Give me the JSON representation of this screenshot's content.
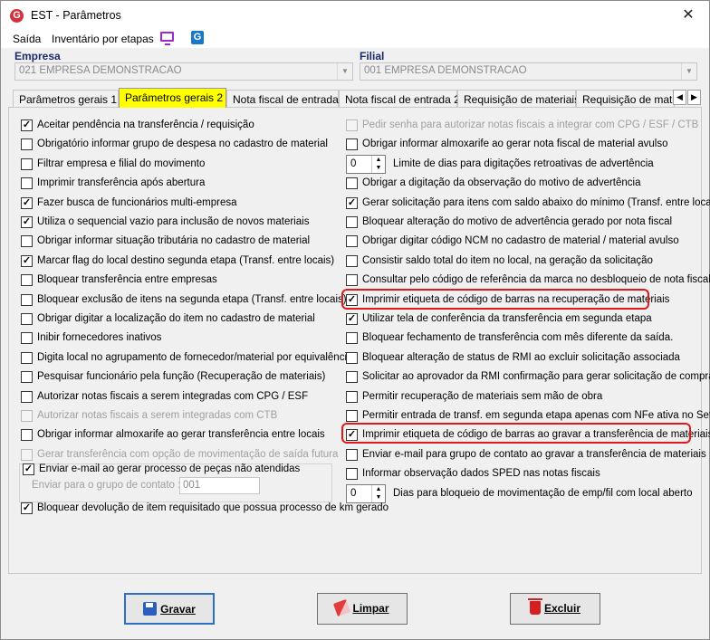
{
  "window": {
    "title": "EST - Parâmetros",
    "close_glyph": "✕",
    "app_icon_letter": "G"
  },
  "menu": {
    "items": [
      "Saída",
      "Inventário por etapas"
    ],
    "g_icon": "G"
  },
  "empresa": {
    "label": "Empresa",
    "value": "021 EMPRESA DEMONSTRACAO"
  },
  "filial": {
    "label": "Filial",
    "value": "001 EMPRESA DEMONSTRACAO"
  },
  "tabs": [
    "Parâmetros gerais 1",
    "Parâmetros gerais 2",
    "Nota fiscal de entrada",
    "Nota fiscal de entrada 2",
    "Requisição de materiais",
    "Requisição de materi"
  ],
  "active_tab": 1,
  "left_options": [
    {
      "label": "Aceitar pendência na transferência / requisição",
      "checked": true,
      "enabled": true
    },
    {
      "label": "Obrigatório informar grupo de despesa no cadastro de material",
      "checked": false,
      "enabled": true
    },
    {
      "label": "Filtrar empresa e filial do movimento",
      "checked": false,
      "enabled": true
    },
    {
      "label": "Imprimir transferência após abertura",
      "checked": false,
      "enabled": true
    },
    {
      "label": "Fazer busca de funcionários multi-empresa",
      "checked": true,
      "enabled": true
    },
    {
      "label": "Utiliza o sequencial vazio para inclusão de novos materiais",
      "checked": true,
      "enabled": true
    },
    {
      "label": "Obrigar informar situação tributária no cadastro de material",
      "checked": false,
      "enabled": true
    },
    {
      "label": "Marcar flag do local destino segunda etapa (Transf. entre locais)",
      "checked": true,
      "enabled": true
    },
    {
      "label": "Bloquear transferência entre empresas",
      "checked": false,
      "enabled": true
    },
    {
      "label": "Bloquear exclusão de itens na segunda etapa (Transf. entre locais)",
      "checked": false,
      "enabled": true
    },
    {
      "label": "Obrigar digitar a localização do item no cadastro de material",
      "checked": false,
      "enabled": true
    },
    {
      "label": "Inibir fornecedores inativos",
      "checked": false,
      "enabled": true
    },
    {
      "label": "Digita local no agrupamento de fornecedor/material por equivalência",
      "checked": false,
      "enabled": true
    },
    {
      "label": "Pesquisar funcionário pela função (Recuperação de materiais)",
      "checked": false,
      "enabled": true
    },
    {
      "label": "Autorizar notas fiscais a serem integradas com CPG / ESF",
      "checked": false,
      "enabled": true
    },
    {
      "label": "Autorizar notas fiscais a serem integradas com CTB",
      "checked": false,
      "enabled": false
    },
    {
      "label": "Obrigar informar almoxarife ao gerar transferência entre locais",
      "checked": false,
      "enabled": true
    },
    {
      "label": "Gerar transferência com opção de movimentação de saída futura",
      "checked": false,
      "enabled": false
    }
  ],
  "email_group": {
    "label": "Enviar e-mail ao gerar processo de peças não atendidas",
    "checked": true,
    "field_label": "Enviar para o grupo de contato :",
    "field_value": "001"
  },
  "bottom_left_option": {
    "label": "Bloquear devolução de item requisitado que possua processo de km gerado",
    "checked": true
  },
  "right_options": [
    {
      "type": "check",
      "label": "Pedir senha para autorizar notas fiscais a integrar com CPG / ESF / CTB",
      "checked": false,
      "enabled": false
    },
    {
      "type": "check",
      "label": "Obrigar informar almoxarife ao gerar nota fiscal de material avulso",
      "checked": false,
      "enabled": true
    },
    {
      "type": "spin",
      "label": "Limite de dias para digitações retroativas de advertência",
      "value": "0"
    },
    {
      "type": "check",
      "label": "Obrigar a digitação da observação do motivo de advertência",
      "checked": false,
      "enabled": true
    },
    {
      "type": "check",
      "label": "Gerar solicitação para itens com saldo abaixo do mínimo (Transf. entre locais)",
      "checked": true,
      "enabled": true
    },
    {
      "type": "check",
      "label": "Bloquear alteração do motivo de advertência gerado por nota fiscal",
      "checked": false,
      "enabled": true
    },
    {
      "type": "check",
      "label": "Obrigar digitar código NCM no cadastro de material / material avulso",
      "checked": false,
      "enabled": true
    },
    {
      "type": "check",
      "label": "Consistir saldo total do item no local, na geração da solicitação",
      "checked": false,
      "enabled": true
    },
    {
      "type": "check",
      "label": "Consultar pelo código de referência da marca no desbloqueio de nota fiscal",
      "checked": false,
      "enabled": true
    },
    {
      "type": "check",
      "label": "Imprimir etiqueta de código de barras na recuperação de materiais",
      "checked": true,
      "enabled": true
    },
    {
      "type": "check",
      "label": "Utilizar tela de conferência da transferência em segunda etapa",
      "checked": true,
      "enabled": true
    },
    {
      "type": "check",
      "label": "Bloquear fechamento de transferência com mês diferente da saída.",
      "checked": false,
      "enabled": true
    },
    {
      "type": "check",
      "label": "Bloquear alteração de status de RMI ao excluir solicitação associada",
      "checked": false,
      "enabled": true
    },
    {
      "type": "check",
      "label": "Solicitar ao aprovador da RMI confirmação para gerar solicitação de compra",
      "checked": false,
      "enabled": true
    },
    {
      "type": "check",
      "label": "Permitir recuperação de materiais sem mão de obra",
      "checked": false,
      "enabled": true
    },
    {
      "type": "check",
      "label": "Permitir entrada de transf. em segunda etapa apenas com NFe ativa no Sefaz",
      "checked": false,
      "enabled": true
    },
    {
      "type": "check",
      "label": "Imprimir etiqueta de código de barras ao gravar a transferência de materiais",
      "checked": true,
      "enabled": true
    },
    {
      "type": "check",
      "label": "Enviar e-mail para grupo de contato ao gravar a transferência de materiais",
      "checked": false,
      "enabled": true
    },
    {
      "type": "check",
      "label": "Informar observação dados SPED nas notas fiscais",
      "checked": false,
      "enabled": true
    },
    {
      "type": "spin",
      "label": "Dias para bloqueio de movimentação de emp/fil com local aberto",
      "value": "0"
    }
  ],
  "buttons": {
    "save": "Gravar",
    "clear": "Limpar",
    "delete": "Excluir"
  },
  "colors": {
    "active_tab": "#ffff00",
    "highlight": "#e01a1a",
    "group_label": "#1a2a6c"
  }
}
